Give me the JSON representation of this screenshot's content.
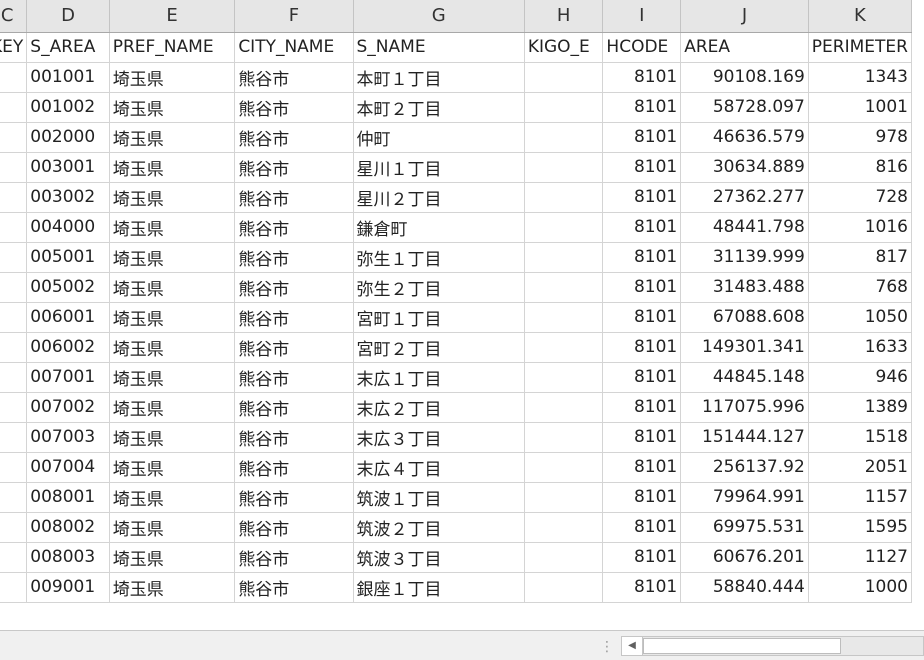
{
  "columns": [
    {
      "letter": "C",
      "header": "KEY"
    },
    {
      "letter": "D",
      "header": "S_AREA"
    },
    {
      "letter": "E",
      "header": "PREF_NAME"
    },
    {
      "letter": "F",
      "header": "CITY_NAME"
    },
    {
      "letter": "G",
      "header": "S_NAME"
    },
    {
      "letter": "H",
      "header": "KIGO_E"
    },
    {
      "letter": "I",
      "header": "HCODE"
    },
    {
      "letter": "J",
      "header": "AREA"
    },
    {
      "letter": "K",
      "header": "PERIMETER"
    }
  ],
  "rows": [
    {
      "key": "",
      "s_area": "001001",
      "pref": "埼玉県",
      "city": "熊谷市",
      "s_name": "本町１丁目",
      "kigo": "",
      "hcode": "8101",
      "area": "90108.169",
      "perim": "1343"
    },
    {
      "key": "",
      "s_area": "001002",
      "pref": "埼玉県",
      "city": "熊谷市",
      "s_name": "本町２丁目",
      "kigo": "",
      "hcode": "8101",
      "area": "58728.097",
      "perim": "1001"
    },
    {
      "key": "",
      "s_area": "002000",
      "pref": "埼玉県",
      "city": "熊谷市",
      "s_name": "仲町",
      "kigo": "",
      "hcode": "8101",
      "area": "46636.579",
      "perim": "978"
    },
    {
      "key": "",
      "s_area": "003001",
      "pref": "埼玉県",
      "city": "熊谷市",
      "s_name": "星川１丁目",
      "kigo": "",
      "hcode": "8101",
      "area": "30634.889",
      "perim": "816"
    },
    {
      "key": "",
      "s_area": "003002",
      "pref": "埼玉県",
      "city": "熊谷市",
      "s_name": "星川２丁目",
      "kigo": "",
      "hcode": "8101",
      "area": "27362.277",
      "perim": "728"
    },
    {
      "key": "",
      "s_area": "004000",
      "pref": "埼玉県",
      "city": "熊谷市",
      "s_name": "鎌倉町",
      "kigo": "",
      "hcode": "8101",
      "area": "48441.798",
      "perim": "1016"
    },
    {
      "key": "",
      "s_area": "005001",
      "pref": "埼玉県",
      "city": "熊谷市",
      "s_name": "弥生１丁目",
      "kigo": "",
      "hcode": "8101",
      "area": "31139.999",
      "perim": "817"
    },
    {
      "key": "",
      "s_area": "005002",
      "pref": "埼玉県",
      "city": "熊谷市",
      "s_name": "弥生２丁目",
      "kigo": "",
      "hcode": "8101",
      "area": "31483.488",
      "perim": "768"
    },
    {
      "key": "",
      "s_area": "006001",
      "pref": "埼玉県",
      "city": "熊谷市",
      "s_name": "宮町１丁目",
      "kigo": "",
      "hcode": "8101",
      "area": "67088.608",
      "perim": "1050"
    },
    {
      "key": "",
      "s_area": "006002",
      "pref": "埼玉県",
      "city": "熊谷市",
      "s_name": "宮町２丁目",
      "kigo": "",
      "hcode": "8101",
      "area": "149301.341",
      "perim": "1633"
    },
    {
      "key": "",
      "s_area": "007001",
      "pref": "埼玉県",
      "city": "熊谷市",
      "s_name": "末広１丁目",
      "kigo": "",
      "hcode": "8101",
      "area": "44845.148",
      "perim": "946"
    },
    {
      "key": "",
      "s_area": "007002",
      "pref": "埼玉県",
      "city": "熊谷市",
      "s_name": "末広２丁目",
      "kigo": "",
      "hcode": "8101",
      "area": "117075.996",
      "perim": "1389"
    },
    {
      "key": "",
      "s_area": "007003",
      "pref": "埼玉県",
      "city": "熊谷市",
      "s_name": "末広３丁目",
      "kigo": "",
      "hcode": "8101",
      "area": "151444.127",
      "perim": "1518"
    },
    {
      "key": "",
      "s_area": "007004",
      "pref": "埼玉県",
      "city": "熊谷市",
      "s_name": "末広４丁目",
      "kigo": "",
      "hcode": "8101",
      "area": "256137.92",
      "perim": "2051"
    },
    {
      "key": "",
      "s_area": "008001",
      "pref": "埼玉県",
      "city": "熊谷市",
      "s_name": "筑波１丁目",
      "kigo": "",
      "hcode": "8101",
      "area": "79964.991",
      "perim": "1157"
    },
    {
      "key": "",
      "s_area": "008002",
      "pref": "埼玉県",
      "city": "熊谷市",
      "s_name": "筑波２丁目",
      "kigo": "",
      "hcode": "8101",
      "area": "69975.531",
      "perim": "1595"
    },
    {
      "key": "",
      "s_area": "008003",
      "pref": "埼玉県",
      "city": "熊谷市",
      "s_name": "筑波３丁目",
      "kigo": "",
      "hcode": "8101",
      "area": "60676.201",
      "perim": "1127"
    },
    {
      "key": "",
      "s_area": "009001",
      "pref": "埼玉県",
      "city": "熊谷市",
      "s_name": "銀座１丁目",
      "kigo": "",
      "hcode": "8101",
      "area": "58840.444",
      "perim": "1000"
    }
  ],
  "scrollbar": {
    "left_arrow": "◀"
  },
  "split_handle": "⋮"
}
